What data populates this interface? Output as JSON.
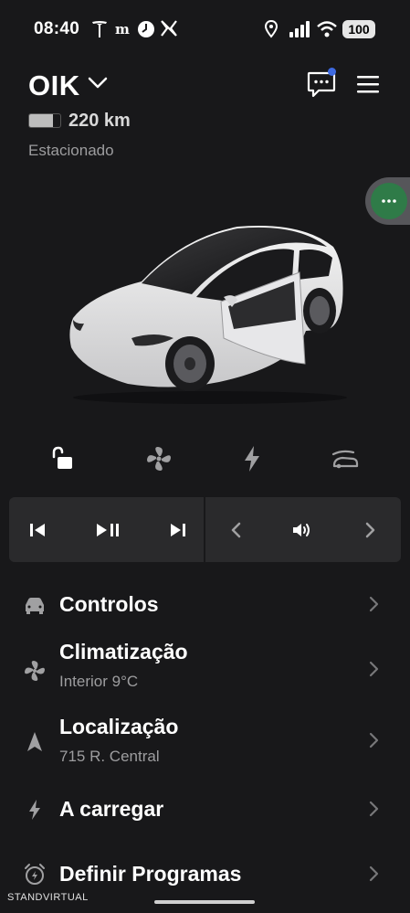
{
  "status_bar": {
    "time": "08:40",
    "battery": "100",
    "icons": [
      "tesla-logo-icon",
      "newspaper-icon",
      "clock-icon",
      "x-icon",
      "location-icon",
      "signal-icon",
      "wifi-icon"
    ]
  },
  "vehicle": {
    "name": "OIK",
    "range": "220 km",
    "battery_level": 0.75,
    "status": "Estacionado"
  },
  "quick_controls": [
    "unlock-icon",
    "fan-icon",
    "charging-bolt-icon",
    "frunk-icon"
  ],
  "media_controls": [
    "previous-track-icon",
    "play-pause-icon",
    "next-track-icon",
    "volume-left-icon",
    "volume-icon",
    "volume-right-icon"
  ],
  "menu": [
    {
      "title": "Controlos",
      "subtitle": "",
      "icon": "car-icon"
    },
    {
      "title": "Climatização",
      "subtitle": "Interior 9°C",
      "icon": "fan-icon"
    },
    {
      "title": "Localização",
      "subtitle": "715 R. Central",
      "icon": "navigation-arrow-icon"
    },
    {
      "title": "A carregar",
      "subtitle": "",
      "icon": "charging-bolt-icon"
    },
    {
      "title": "Definir Programas",
      "subtitle": "",
      "icon": "alarm-clock-icon"
    }
  ],
  "watermark": "STANDVIRTUAL",
  "colors": {
    "background": "#18181a",
    "panel": "#2a2a2c",
    "secondary_text": "#9d9d9f",
    "notification_dot": "#3e6ae1",
    "handle_green": "#2f7b48"
  }
}
